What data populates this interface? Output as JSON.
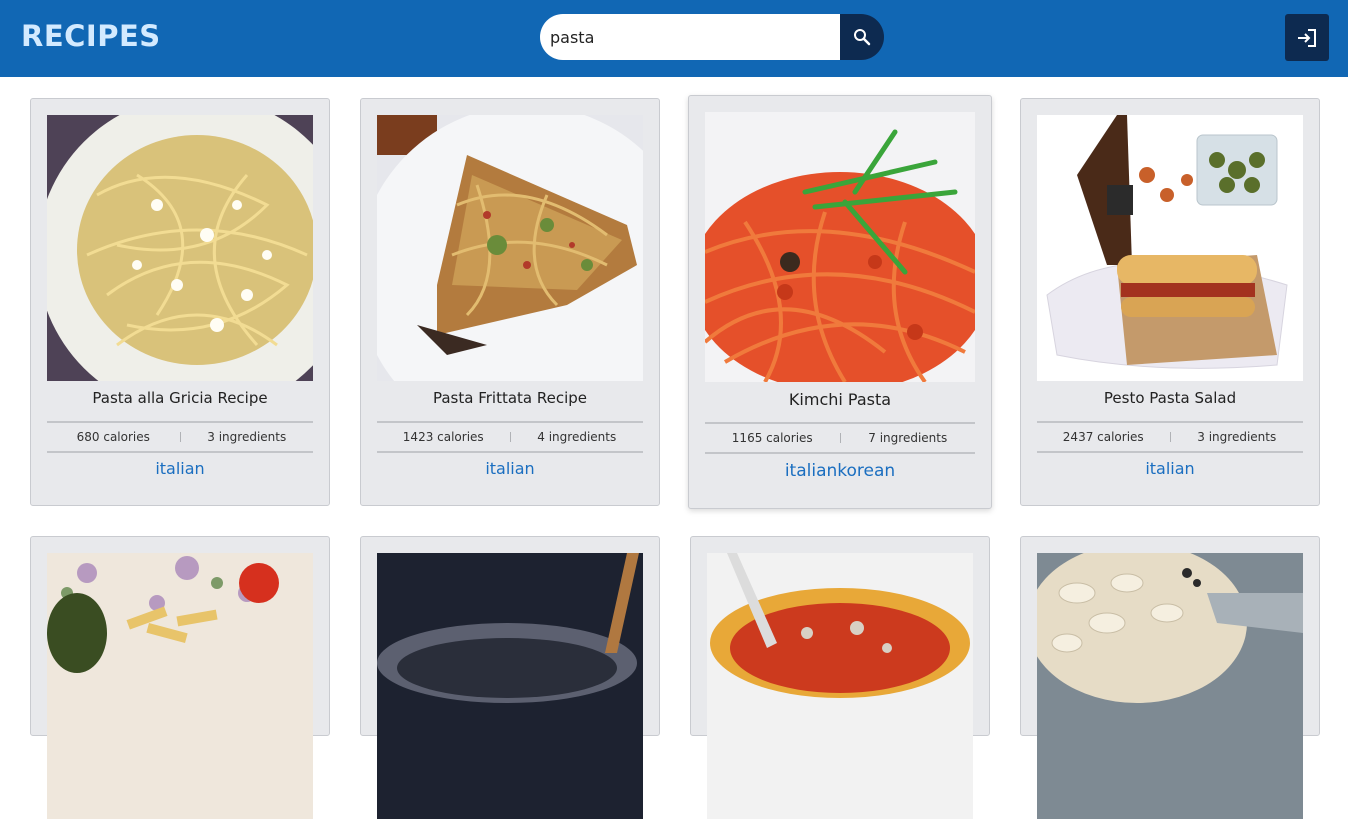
{
  "header": {
    "logo": "RECIPES",
    "search_value": "pasta",
    "colors": {
      "bar": "#1167b4",
      "button": "#0d2a50",
      "logo": "#d3eaff"
    }
  },
  "cards": [
    {
      "title": "Pasta alla Gricia Recipe",
      "calories": "680 calories",
      "ingredients": "3 ingredients",
      "cuisine": "italian"
    },
    {
      "title": "Pasta Frittata Recipe",
      "calories": "1423 calories",
      "ingredients": "4 ingredients",
      "cuisine": "italian"
    },
    {
      "title": "Kimchi Pasta",
      "calories": "1165 calories",
      "ingredients": "7 ingredients",
      "cuisine": "italiankorean"
    },
    {
      "title": "Pesto Pasta Salad",
      "calories": "2437 calories",
      "ingredients": "3 ingredients",
      "cuisine": "italian"
    }
  ]
}
